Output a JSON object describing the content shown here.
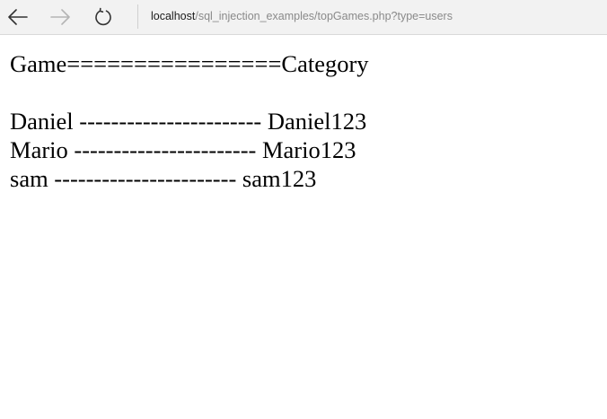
{
  "browser": {
    "back_icon": "arrow-left-icon",
    "forward_icon": "arrow-right-icon",
    "refresh_icon": "refresh-icon",
    "address_host": "localhost",
    "address_path": "/sql_injection_examples/topGames.php?type=users",
    "colors": {
      "toolbar_bg": "#f2f2f2",
      "host_text": "#1a1a1a",
      "path_text": "#8a8a8a"
    }
  },
  "page": {
    "header": "Game================Category",
    "rows": [
      "Daniel ----------------------- Daniel123",
      "Mario ----------------------- Mario123",
      "sam ----------------------- sam123"
    ]
  }
}
